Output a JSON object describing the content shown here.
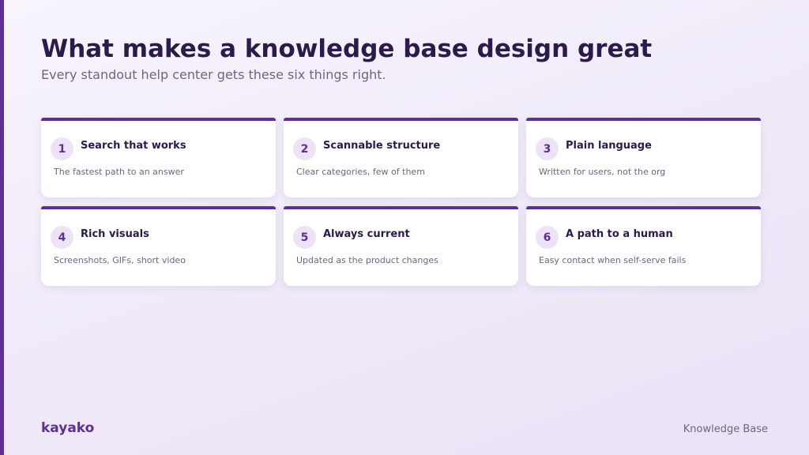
{
  "header": {
    "title": "What makes a knowledge base design great",
    "subtitle": "Every standout help center gets these six things right."
  },
  "cards": [
    {
      "number": "1",
      "title": "Search that works",
      "description": "The fastest path to an answer"
    },
    {
      "number": "2",
      "title": "Scannable structure",
      "description": "Clear categories, few of them"
    },
    {
      "number": "3",
      "title": "Plain language",
      "description": "Written for users, not the org"
    },
    {
      "number": "4",
      "title": "Rich visuals",
      "description": "Screenshots, GIFs, short video"
    },
    {
      "number": "5",
      "title": "Always current",
      "description": "Updated as the product changes"
    },
    {
      "number": "6",
      "title": "A path to a human",
      "description": "Easy contact when self-serve fails"
    }
  ],
  "footer": {
    "logo": "kayako",
    "label": "Knowledge Base"
  },
  "colors": {
    "accent": "#5f2e96",
    "title": "#2c1a4d",
    "muted": "#6f6486",
    "badge_bg": "#ece4f6"
  }
}
